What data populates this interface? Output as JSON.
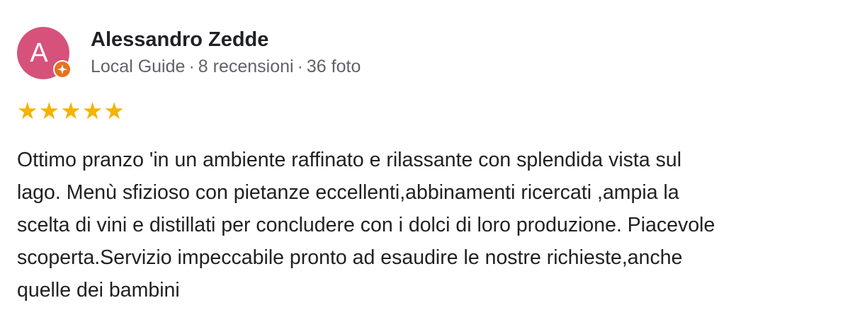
{
  "reviewer": {
    "avatar_letter": "A",
    "avatar_color": "#d6527a",
    "badge_color": "#e8711c",
    "name": "Alessandro Zedde",
    "level": "Local Guide",
    "separator": "·",
    "reviews_count": "8 recensioni",
    "photos_count": "36 foto"
  },
  "rating": {
    "stars": 5,
    "max_stars": 5,
    "star_color": "#f4b400",
    "star_glyph": "★"
  },
  "review": {
    "lines": [
      "Ottimo pranzo 'in un ambiente raffinato e rilassante con splendida vista sul",
      "lago. Menù sfizioso con pietanze eccellenti,abbinamenti ricercati ,ampia la",
      "scelta di vini e distillati per concludere con i dolci di loro produzione. Piacevole",
      "scoperta.Servizio impeccabile pronto ad esaudire le nostre richieste,anche",
      "quelle dei bambini"
    ]
  }
}
